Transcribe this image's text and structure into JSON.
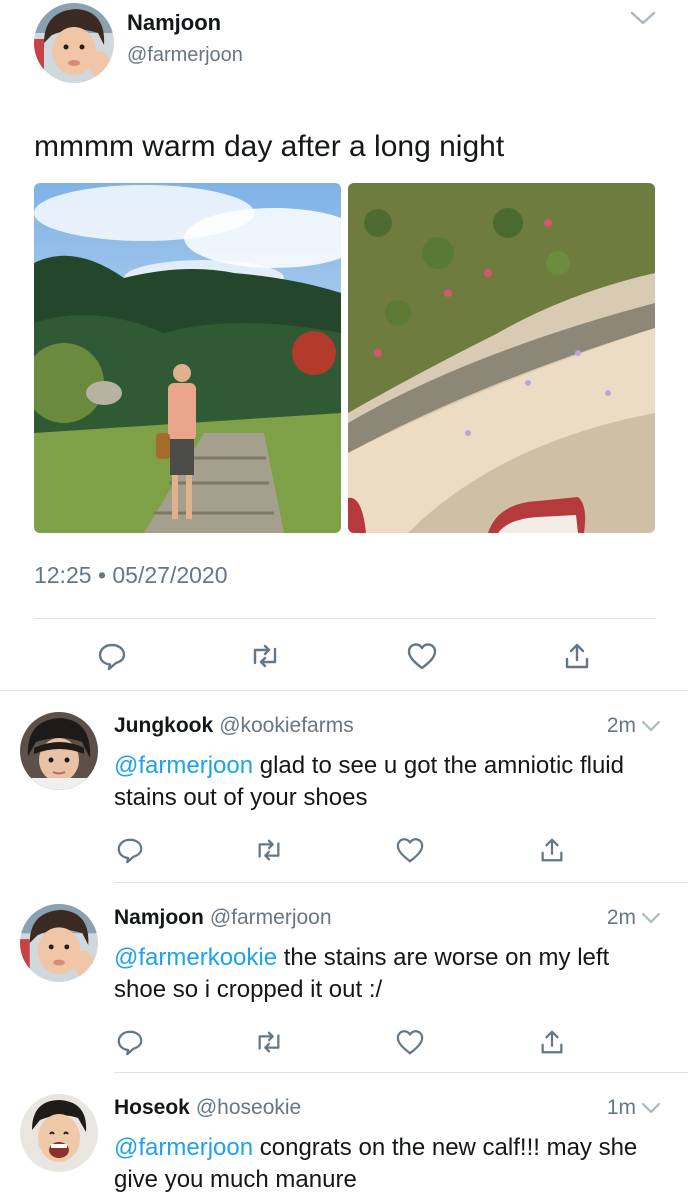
{
  "main": {
    "name": "Namjoon",
    "handle": "@farmerjoon",
    "text": "mmmm warm day after a long night",
    "timestamp": "12:25 • 05/27/2020"
  },
  "replies": [
    {
      "name": "Jungkook",
      "handle": "@kookiefarms",
      "time": "2m",
      "mention": "@farmerjoon",
      "text": " glad to see u got the amniotic fluid stains out of your shoes"
    },
    {
      "name": "Namjoon",
      "handle": "@farmerjoon",
      "time": "2m",
      "mention": "@farmerkookie",
      "text": " the stains are worse on my left shoe so i cropped it out :/"
    },
    {
      "name": "Hoseok",
      "handle": "@hoseokie",
      "time": "1m",
      "mention": "@farmerjoon",
      "text": " congrats on the new calf!!! may she give you much manure"
    }
  ],
  "icons": {
    "reply": "reply-icon",
    "retweet": "retweet-icon",
    "like": "heart-icon",
    "share": "share-icon",
    "caret": "chevron-down-icon"
  },
  "colors": {
    "text": "#14171a",
    "secondary": "#657786",
    "link": "#1da1f2",
    "divider": "#dfe3e7"
  }
}
